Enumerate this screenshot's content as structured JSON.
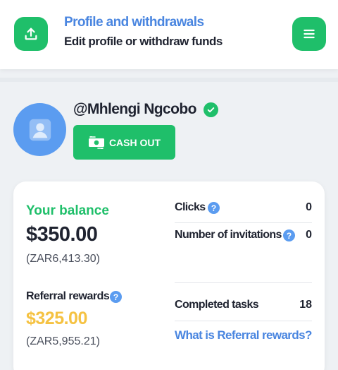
{
  "header": {
    "title": "Profile and withdrawals",
    "subtitle": "Edit profile or withdraw funds",
    "upload_icon": "upload-icon",
    "menu_icon": "hamburger-menu-icon"
  },
  "profile": {
    "username": "@Mhlengi Ngcobo",
    "verified_icon": "check-circle-icon",
    "avatar_icon": "user-avatar-icon",
    "cashout_label": "CASH OUT",
    "cashout_icon": "money-exchange-icon"
  },
  "balance": {
    "label": "Your balance",
    "value": "$350.00",
    "local_value": "(ZAR6,413.30)"
  },
  "stats": {
    "clicks_label": "Clicks",
    "clicks_value": "0",
    "invitations_label": "Number of invitations",
    "invitations_value": "0",
    "completed_label": "Completed tasks",
    "completed_value": "18",
    "help_symbol": "?"
  },
  "referral": {
    "label": "Referral rewards",
    "value": "$325.00",
    "local_value": "(ZAR5,955.21)",
    "link_text": "What is Referral rewards?"
  },
  "colors": {
    "accent_green": "#1fbf6a",
    "accent_blue": "#4a86e0",
    "gold": "#f5c242"
  }
}
